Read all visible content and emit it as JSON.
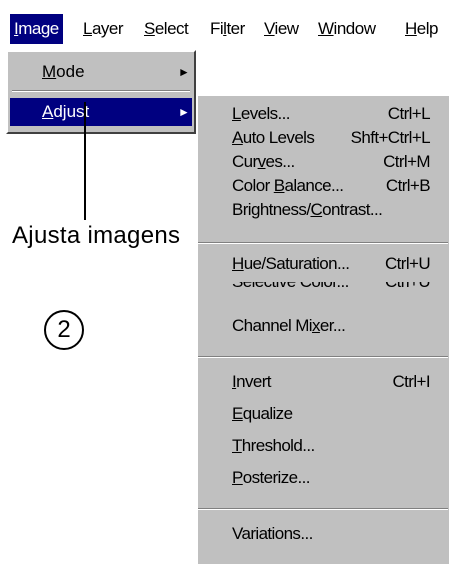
{
  "menubar": {
    "items": [
      {
        "pre": "",
        "key": "I",
        "post": "mage"
      },
      {
        "pre": "",
        "key": "L",
        "post": "ayer"
      },
      {
        "pre": "",
        "key": "S",
        "post": "elect"
      },
      {
        "pre": "Fi",
        "key": "l",
        "post": "ter"
      },
      {
        "pre": "",
        "key": "V",
        "post": "iew"
      },
      {
        "pre": "",
        "key": "W",
        "post": "indow"
      },
      {
        "pre": "",
        "key": "H",
        "post": "elp"
      }
    ]
  },
  "image_menu": {
    "items": [
      {
        "pre": "",
        "key": "M",
        "post": "ode",
        "arrow": "►"
      },
      {
        "pre": "",
        "key": "A",
        "post": "djust",
        "arrow": "►"
      }
    ]
  },
  "adjust_menu": {
    "items": [
      {
        "pre": "",
        "key": "L",
        "post": "evels...",
        "shortcut": "Ctrl+L"
      },
      {
        "pre": "",
        "key": "A",
        "post": "uto Levels",
        "shortcut": "Shft+Ctrl+L"
      },
      {
        "pre": "Cur",
        "key": "v",
        "post": "es...",
        "shortcut": "Ctrl+M"
      },
      {
        "pre": "Color ",
        "key": "B",
        "post": "alance...",
        "shortcut": "Ctrl+B"
      },
      {
        "pre": "Brightness/",
        "key": "C",
        "post": "ontrast...",
        "shortcut": ""
      },
      {
        "pre": "",
        "key": "H",
        "post": "ue/Saturation...",
        "shortcut": "Ctrl+U"
      },
      {
        "pre": "Selective Color...",
        "key": "",
        "post": "",
        "shortcut": "Ctrl+U"
      },
      {
        "pre": "Channel Mi",
        "key": "x",
        "post": "er...",
        "shortcut": ""
      },
      {
        "pre": "",
        "key": "I",
        "post": "nvert",
        "shortcut": "Ctrl+I"
      },
      {
        "pre": "",
        "key": "E",
        "post": "qualize",
        "shortcut": ""
      },
      {
        "pre": "",
        "key": "T",
        "post": "hreshold...",
        "shortcut": ""
      },
      {
        "pre": "",
        "key": "P",
        "post": "osterize...",
        "shortcut": ""
      },
      {
        "pre": "Variations...",
        "key": "",
        "post": "",
        "shortcut": ""
      }
    ]
  },
  "annotation": {
    "callout_text": "Ajusta imagens",
    "step_number": "2"
  },
  "colors": {
    "highlight": "#000080",
    "menu_face": "#c0c0c0",
    "highlight_text": "#ffffff"
  }
}
